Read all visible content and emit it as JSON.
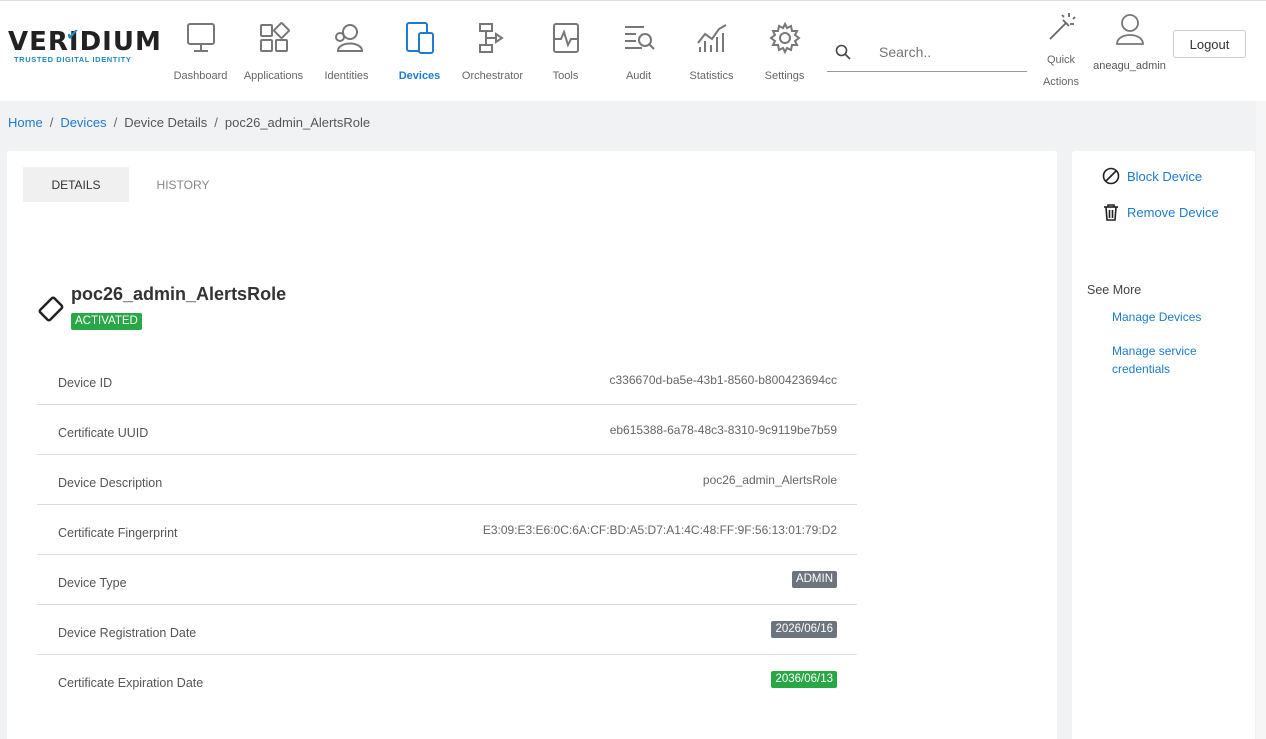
{
  "brand": {
    "name": "VERIDIUM",
    "tagline": "TRUSTED DIGITAL IDENTITY",
    "accent": "#1e7bd0"
  },
  "nav": [
    {
      "label": "Dashboard",
      "icon": "monitor-icon"
    },
    {
      "label": "Applications",
      "icon": "apps-grid-icon"
    },
    {
      "label": "Identities",
      "icon": "users-icon"
    },
    {
      "label": "Devices",
      "icon": "devices-icon",
      "active": true
    },
    {
      "label": "Orchestrator",
      "icon": "flow-icon"
    },
    {
      "label": "Tools",
      "icon": "pulse-icon"
    },
    {
      "label": "Audit",
      "icon": "audit-search-icon"
    },
    {
      "label": "Statistics",
      "icon": "chart-icon"
    },
    {
      "label": "Settings",
      "icon": "gear-icon"
    }
  ],
  "search": {
    "placeholder": "Search.."
  },
  "quick_actions": {
    "label": "Quick Actions"
  },
  "user": {
    "name": "aneagu_admin"
  },
  "logout_label": "Logout",
  "breadcrumb": {
    "home": "Home",
    "devices": "Devices",
    "details": "Device Details",
    "current": "poc26_admin_AlertsRole"
  },
  "tabs": {
    "details": "DETAILS",
    "history": "HISTORY"
  },
  "device": {
    "name": "poc26_admin_AlertsRole",
    "status": "ACTIVATED",
    "fields": {
      "id_label": "Device ID",
      "id_value": "c336670d-ba5e-43b1-8560-b800423694cc",
      "cert_uuid_label": "Certificate UUID",
      "cert_uuid_value": "eb615388-6a78-48c3-8310-9c9119be7b59",
      "desc_label": "Device Description",
      "desc_value": "poc26_admin_AlertsRole",
      "fingerprint_label": "Certificate Fingerprint",
      "fingerprint_value": "E3:09:E3:E6:0C:6A:CF:BD:A5:D7:A1:4C:48:FF:9F:56:13:01:79:D2",
      "type_label": "Device Type",
      "type_value": "ADMIN",
      "reg_label": "Device Registration Date",
      "reg_value": "2026/06/16",
      "exp_label": "Certificate Expiration Date",
      "exp_value": "2036/06/13"
    }
  },
  "side": {
    "block": "Block Device",
    "remove": "Remove Device",
    "see_more": "See More",
    "manage_devices": "Manage Devices",
    "manage_credentials": "Manage service credentials"
  }
}
